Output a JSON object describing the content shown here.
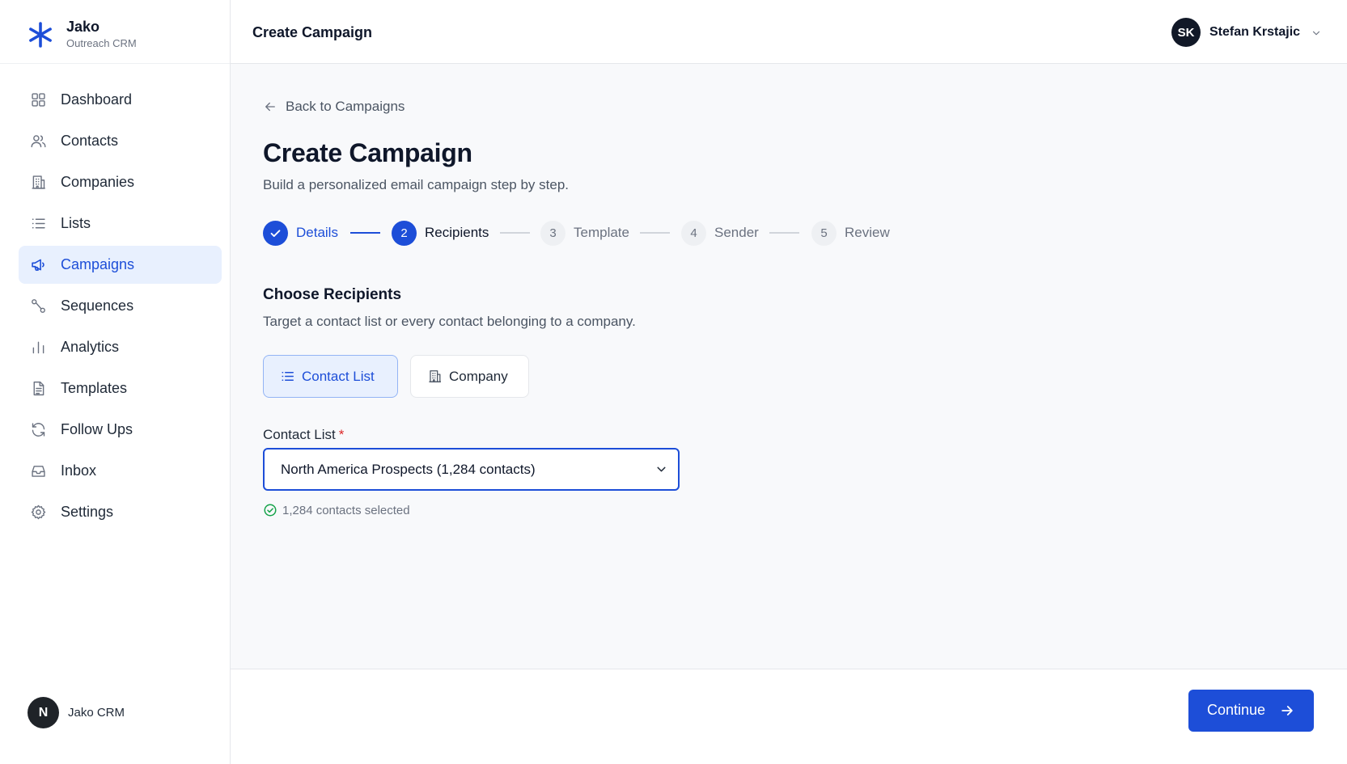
{
  "brand": {
    "name": "Jako",
    "subtitle": "Outreach CRM",
    "logo_icon": "asterisk-logo-icon",
    "accent_color": "#1d4ed8"
  },
  "sidebar": {
    "items": [
      {
        "label": "Dashboard",
        "icon": "grid-icon",
        "active": false
      },
      {
        "label": "Contacts",
        "icon": "users-icon",
        "active": false
      },
      {
        "label": "Companies",
        "icon": "building-icon",
        "active": false
      },
      {
        "label": "Lists",
        "icon": "list-icon",
        "active": false
      },
      {
        "label": "Campaigns",
        "icon": "megaphone-icon",
        "active": true
      },
      {
        "label": "Sequences",
        "icon": "route-icon",
        "active": false
      },
      {
        "label": "Analytics",
        "icon": "bar-chart-icon",
        "active": false
      },
      {
        "label": "Templates",
        "icon": "file-text-icon",
        "active": false
      },
      {
        "label": "Follow Ups",
        "icon": "refresh-icon",
        "active": false
      },
      {
        "label": "Inbox",
        "icon": "inbox-icon",
        "active": false
      },
      {
        "label": "Settings",
        "icon": "gear-icon",
        "active": false
      }
    ],
    "footer": {
      "avatar_initial": "N",
      "name": "Jako CRM"
    }
  },
  "topbar": {
    "title": "Create Campaign",
    "user": {
      "initials": "SK",
      "name": "Stefan Krstajic"
    }
  },
  "main": {
    "back_label": "Back to Campaigns",
    "title": "Create Campaign",
    "subtitle": "Build a personalized email campaign step by step.",
    "steps": [
      {
        "number": "1",
        "label": "Details",
        "state": "done"
      },
      {
        "number": "2",
        "label": "Recipients",
        "state": "current"
      },
      {
        "number": "3",
        "label": "Template",
        "state": "pending"
      },
      {
        "number": "4",
        "label": "Sender",
        "state": "pending"
      },
      {
        "number": "5",
        "label": "Review",
        "state": "pending"
      }
    ],
    "section_title": "Choose Recipients",
    "section_subtitle": "Target a contact list or every contact belonging to a company.",
    "recipient_types": {
      "contact_list": "Contact List",
      "company": "Company",
      "selected": "Contact List"
    },
    "field_label": "Contact List",
    "required_marker": "*",
    "select_value": "North America Prospects (1,284 contacts)",
    "selected_count": "1,284 contacts selected"
  },
  "footer": {
    "continue_label": "Continue"
  },
  "colors": {
    "primary": "#1d4ed8",
    "success": "#16a34a",
    "required": "#dc2626",
    "background": "#f8f9fb"
  }
}
